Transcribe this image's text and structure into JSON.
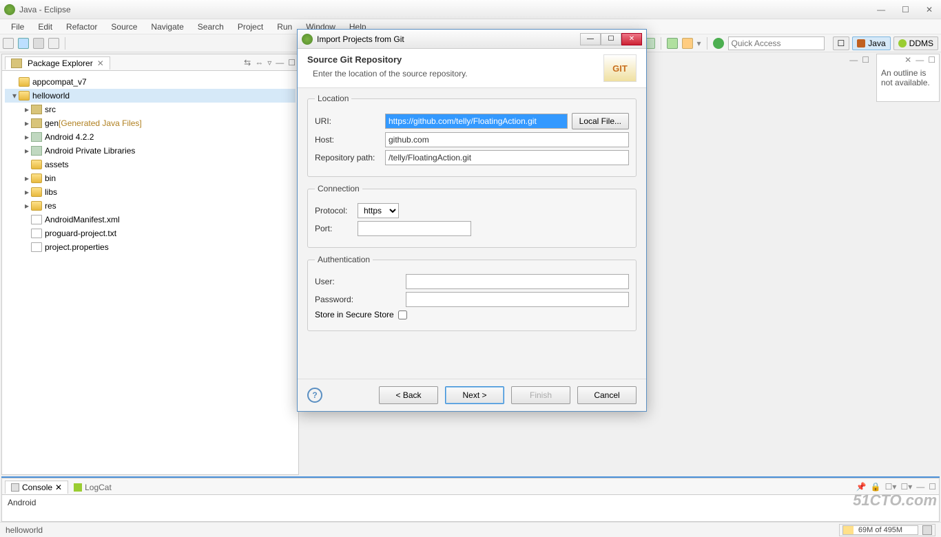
{
  "window": {
    "title": "Java - Eclipse"
  },
  "menu": [
    "File",
    "Edit",
    "Refactor",
    "Source",
    "Navigate",
    "Search",
    "Project",
    "Run",
    "Window",
    "Help"
  ],
  "quickAccess": {
    "placeholder": "Quick Access"
  },
  "perspectives": {
    "java": "Java",
    "ddms": "DDMS"
  },
  "pkgExplorer": {
    "title": "Package Explorer",
    "items": [
      {
        "label": "appcompat_v7",
        "type": "proj",
        "indent": 0,
        "twist": ""
      },
      {
        "label": "helloworld",
        "type": "proj",
        "indent": 0,
        "twist": "▾",
        "sel": true
      },
      {
        "label": "src",
        "type": "pkg",
        "indent": 1,
        "twist": "▸"
      },
      {
        "label": "gen",
        "suffix": " [Generated Java Files]",
        "type": "pkg",
        "indent": 1,
        "twist": "▸"
      },
      {
        "label": "Android 4.2.2",
        "type": "lib",
        "indent": 1,
        "twist": "▸"
      },
      {
        "label": "Android Private Libraries",
        "type": "lib",
        "indent": 1,
        "twist": "▸"
      },
      {
        "label": "assets",
        "type": "folder",
        "indent": 1,
        "twist": ""
      },
      {
        "label": "bin",
        "type": "folder",
        "indent": 1,
        "twist": "▸"
      },
      {
        "label": "libs",
        "type": "folder",
        "indent": 1,
        "twist": "▸"
      },
      {
        "label": "res",
        "type": "folder",
        "indent": 1,
        "twist": "▸"
      },
      {
        "label": "AndroidManifest.xml",
        "type": "file",
        "indent": 1,
        "twist": ""
      },
      {
        "label": "proguard-project.txt",
        "type": "file",
        "indent": 1,
        "twist": ""
      },
      {
        "label": "project.properties",
        "type": "file",
        "indent": 1,
        "twist": ""
      }
    ]
  },
  "outline": {
    "text": "An outline is not available."
  },
  "console": {
    "tab": "Console",
    "tab2": "LogCat",
    "body": "Android"
  },
  "status": {
    "left": "helloworld",
    "mem": "69M of 495M"
  },
  "dialog": {
    "title": "Import Projects from Git",
    "headerTitle": "Source Git Repository",
    "headerSub": "Enter the location of the source repository.",
    "gitBadge": "GIT",
    "locLegend": "Location",
    "uriLabel": "URI:",
    "uriValue": "https://github.com/telly/FloatingAction.git",
    "localFile": "Local File...",
    "hostLabel": "Host:",
    "hostValue": "github.com",
    "repoLabel": "Repository path:",
    "repoValue": "/telly/FloatingAction.git",
    "connLegend": "Connection",
    "protoLabel": "Protocol:",
    "protoValue": "https",
    "portLabel": "Port:",
    "portValue": "",
    "authLegend": "Authentication",
    "userLabel": "User:",
    "userValue": "",
    "passLabel": "Password:",
    "passValue": "",
    "storeLabel": "Store in Secure Store",
    "back": "< Back",
    "next": "Next >",
    "finish": "Finish",
    "cancel": "Cancel"
  },
  "watermark": "51CTO.com"
}
